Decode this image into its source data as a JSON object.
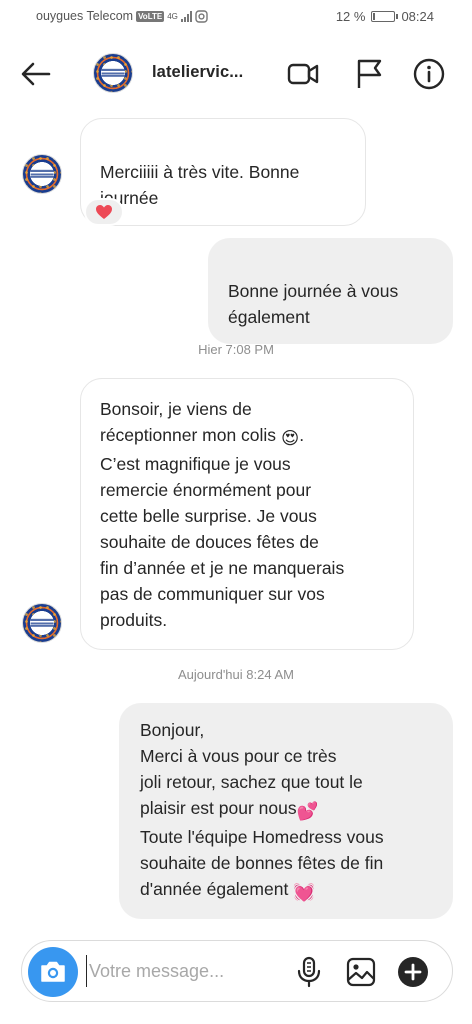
{
  "status_bar": {
    "carrier": "ouygues Telecom",
    "volte": "VoLTE",
    "network": "4G",
    "battery": "12 %",
    "battery_level": 0.12,
    "time": "08:24"
  },
  "header": {
    "username": "lateliervic..."
  },
  "messages": [
    {
      "direction": "received",
      "text": "Merciiiii à très vite. Bonne\njournée",
      "reaction": "❤"
    },
    {
      "direction": "sent",
      "text": "Bonne journée à vous\négalement"
    },
    {
      "direction": "received",
      "text": "Bonsoir, je viens de\nréceptionner mon colis",
      "emoji": "😍",
      "text_after_emoji": ".\nC’est magnifique je vous\nremercie énormément pour\ncette belle surprise. Je vous\nsouhaite de douces fêtes de\nfin d’année et je ne manquerais\npas de communiquer sur vos\nproduits."
    },
    {
      "direction": "sent",
      "text": "Bonjour,\nMerci à vous pour ce très\njoli retour, sachez que tout le\nplaisir est pour nous",
      "emoji": "💕",
      "text_after_emoji": "\nToute l'équipe Homedress vous\nsouhaite de bonnes fêtes de fin\nd'année également ",
      "emoji_end": "💓"
    }
  ],
  "timestamps": [
    "Hier 7:08 PM",
    "Aujourd'hui 8:24 AM"
  ],
  "composer": {
    "placeholder": "Votre message..."
  },
  "colors": {
    "accent": "#3897f0",
    "sent_bubble": "#efefef",
    "heart": "#ed4956"
  },
  "icons": [
    "back-arrow-icon",
    "video-call-icon",
    "flag-icon",
    "info-icon",
    "camera-icon",
    "microphone-icon",
    "gallery-icon",
    "add-icon"
  ]
}
